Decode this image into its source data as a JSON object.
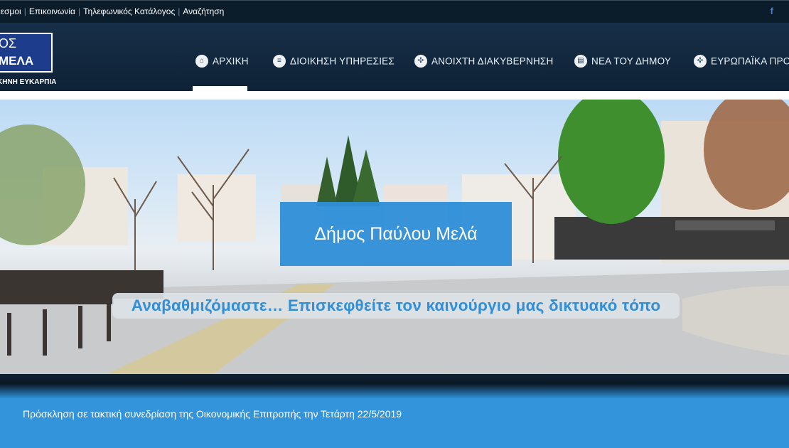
{
  "topbar": {
    "links": [
      "θεσμοι",
      "Επικοινωνία",
      "Τηλεφωνικός Κατάλογος",
      "Αναζήτηση"
    ],
    "social_icon": "facebook-icon",
    "social_label": "f"
  },
  "logo": {
    "line1": "ΟΣ",
    "line2": "ΜΕΛΑ",
    "subtitle": "ΚΗΝΗ ΕΥΚΑΡΠΙΑ"
  },
  "nav": {
    "items": [
      {
        "label": "ΑΡΧΙΚΗ",
        "icon": "home-icon",
        "active": true
      },
      {
        "label": "ΔΙΟΙΚΗΣΗ ΥΠΗΡΕΣΙΕΣ",
        "icon": "menu-icon",
        "active": false
      },
      {
        "label": "ΑΝΟΙΧΤΗ ΔΙΑΚΥΒΕΡΝΗΣΗ",
        "icon": "network-icon",
        "active": false
      },
      {
        "label": "ΝΕΑ ΤΟΥ ΔΗΜΟΥ",
        "icon": "document-icon",
        "active": false
      },
      {
        "label": "ΕΥΡΩΠΑΪΚΑ ΠΡΟΓ",
        "icon": "network-icon",
        "active": false
      }
    ]
  },
  "hero": {
    "title": "Δήμος Παύλου Μελά",
    "subtitle": "Αναβαθμιζόμαστε… Επισκεφθείτε τον καινούργιο μας δικτυακό τόπο"
  },
  "news": {
    "headline": "Πρόσκληση σε τακτική συνεδρίαση της Οικονομικής Επιτροπής την Τετάρτη 22/5/2019"
  },
  "colors": {
    "topbar_bg": "#0b1c2b",
    "header_bg": "#172f48",
    "accent_blue": "#2f8fd8",
    "news_bg": "#3394dc"
  }
}
